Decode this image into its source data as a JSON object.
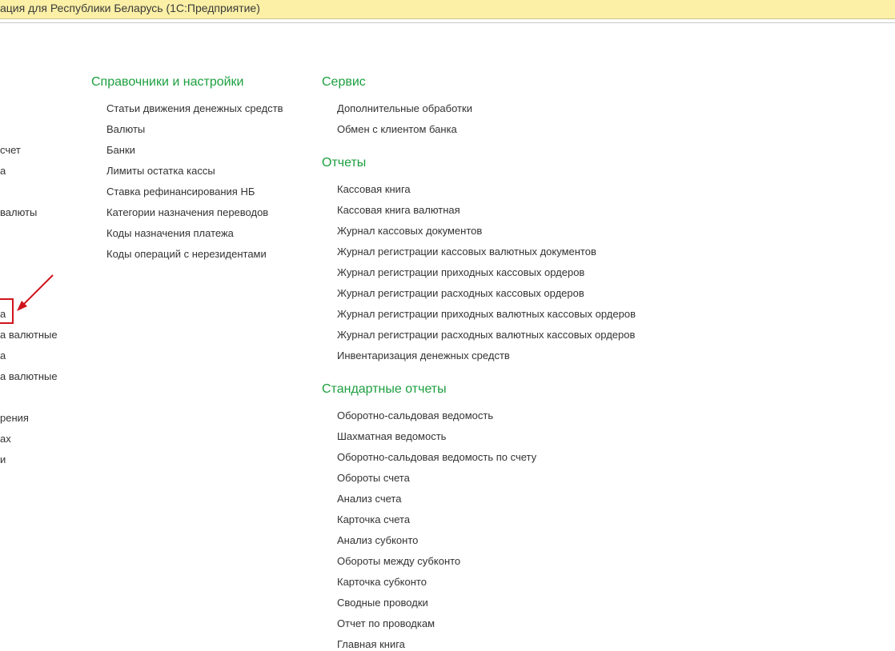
{
  "window": {
    "title": "ация для Республики Беларусь  (1С:Предприятие)"
  },
  "left_panel": {
    "items": [
      "счет",
      "а",
      "валюты",
      "а",
      "а валютные",
      "а",
      "а валютные",
      "рения",
      "ах",
      "и"
    ]
  },
  "references": {
    "title": "Справочники и настройки",
    "items": [
      "Статьи движения денежных средств",
      "Валюты",
      "Банки",
      "Лимиты остатка кассы",
      "Ставка рефинансирования НБ",
      "Категории назначения переводов",
      "Коды назначения платежа",
      "Коды операций с нерезидентами"
    ]
  },
  "service": {
    "title": "Сервис",
    "items": [
      "Дополнительные обработки",
      "Обмен с клиентом банка"
    ]
  },
  "reports": {
    "title": "Отчеты",
    "items": [
      "Кассовая книга",
      "Кассовая книга валютная",
      "Журнал кассовых документов",
      "Журнал регистрации кассовых валютных документов",
      "Журнал регистрации приходных кассовых ордеров",
      "Журнал регистрации расходных кассовых ордеров",
      "Журнал регистрации приходных валютных кассовых ордеров",
      "Журнал регистрации расходных валютных кассовых ордеров",
      "Инвентаризация денежных средств"
    ]
  },
  "standard_reports": {
    "title": "Стандартные отчеты",
    "items": [
      "Оборотно-сальдовая ведомость",
      "Шахматная ведомость",
      "Оборотно-сальдовая ведомость по счету",
      "Обороты счета",
      "Анализ счета",
      "Карточка счета",
      "Анализ субконто",
      "Обороты между субконто",
      "Карточка субконто",
      "Сводные проводки",
      "Отчет по проводкам",
      "Главная книга"
    ]
  },
  "colors": {
    "section_title": "#1c9f3f",
    "titlebar_bg": "#fbf0a6",
    "annotation_red": "#d0141c"
  }
}
